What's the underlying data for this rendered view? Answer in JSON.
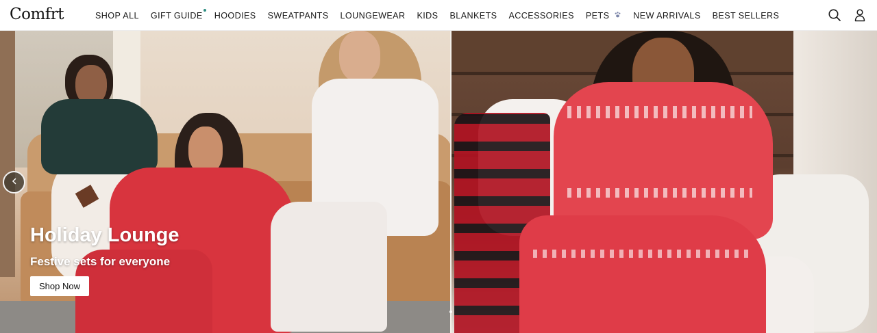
{
  "header": {
    "logo": "Comfrt",
    "nav": [
      {
        "label": "SHOP ALL"
      },
      {
        "label": "GIFT GUIDE"
      },
      {
        "label": "HOODIES"
      },
      {
        "label": "SWEATPANTS"
      },
      {
        "label": "LOUNGEWEAR"
      },
      {
        "label": "KIDS"
      },
      {
        "label": "BLANKETS"
      },
      {
        "label": "ACCESSORIES"
      },
      {
        "label": "PETS"
      },
      {
        "label": "NEW ARRIVALS"
      },
      {
        "label": "BEST SELLERS"
      }
    ],
    "icons": {
      "search": "search-icon",
      "account": "user-icon",
      "pets_badge": "paw-icon",
      "new_indicator": "dot"
    }
  },
  "hero": {
    "title": "Holiday Lounge",
    "subtitle": "Festive sets for everyone",
    "cta": "Shop Now",
    "colors": {
      "accent_dot": "#2f8f83",
      "pajama_red": "#d8343e",
      "fairisle_red": "#e3454f"
    }
  }
}
